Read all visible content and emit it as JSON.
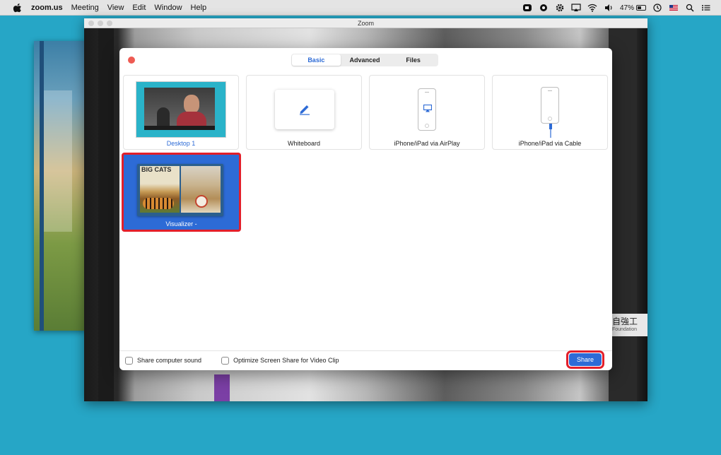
{
  "menubar": {
    "app_name": "zoom.us",
    "menus": [
      "Meeting",
      "View",
      "Edit",
      "Window",
      "Help"
    ],
    "status": {
      "battery": "47%",
      "battery_level": 0.47
    }
  },
  "zoom_window": {
    "title": "Zoom",
    "sign_text": "自強工",
    "sign_subtext": "Foundation"
  },
  "share_dialog": {
    "tabs": [
      {
        "label": "Basic",
        "active": true
      },
      {
        "label": "Advanced",
        "active": false
      },
      {
        "label": "Files",
        "active": false
      }
    ],
    "tiles": [
      {
        "label": "Desktop 1",
        "icon": "desktop-thumbnail",
        "selected": false
      },
      {
        "label": "Whiteboard",
        "icon": "pen-icon",
        "selected": false
      },
      {
        "label": "iPhone/iPad via AirPlay",
        "icon": "airplay-icon",
        "selected": false
      },
      {
        "label": "iPhone/iPad via Cable",
        "icon": "cable-icon",
        "selected": false
      },
      {
        "label": "Visualizer -",
        "icon": "book-thumbnail",
        "selected": true,
        "book_title": "BIG CATS"
      }
    ],
    "footer": {
      "share_sound_label": "Share computer sound",
      "share_sound_checked": false,
      "optimize_label": "Optimize Screen Share for Video Clip",
      "optimize_checked": false,
      "share_button": "Share"
    }
  },
  "colors": {
    "desktop": "#26a6c6",
    "accent": "#2d6bd6",
    "highlight": "#e31f2a"
  }
}
